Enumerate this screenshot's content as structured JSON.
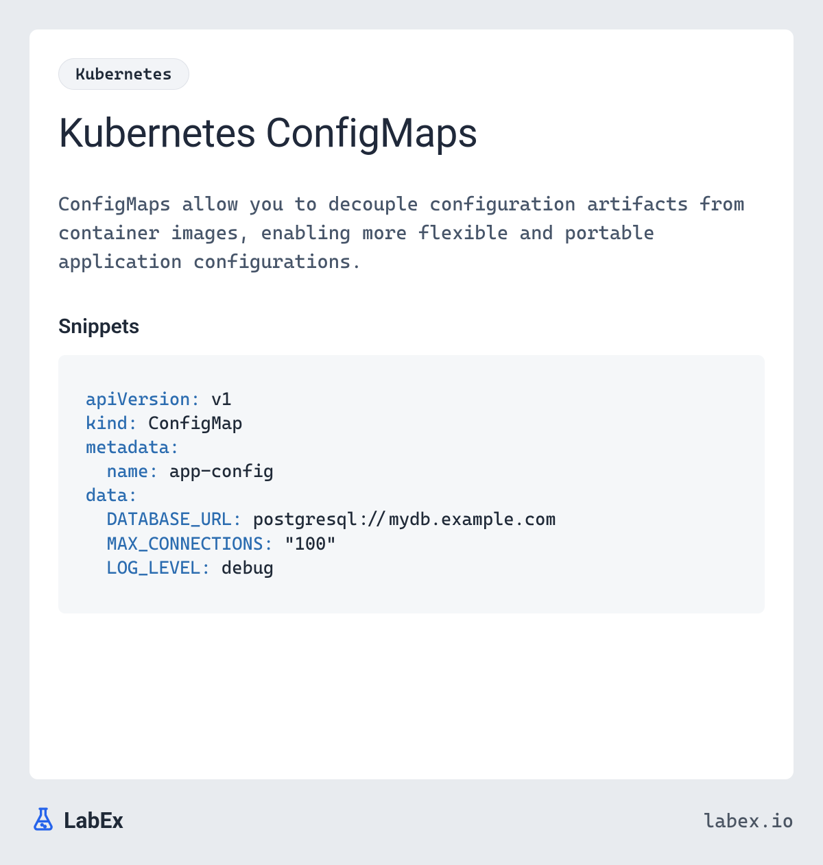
{
  "tag": "Kubernetes",
  "title": "Kubernetes ConfigMaps",
  "description": "ConfigMaps allow you to decouple configuration artifacts from container images, enabling more flexible and portable application configurations.",
  "snippets_heading": "Snippets",
  "code": {
    "lines": [
      {
        "key": "apiVersion:",
        "value": " v1",
        "indent": 0
      },
      {
        "key": "kind:",
        "value": " ConfigMap",
        "indent": 0
      },
      {
        "key": "metadata:",
        "value": "",
        "indent": 0
      },
      {
        "key": "name:",
        "value": " app-config",
        "indent": 1
      },
      {
        "key": "data:",
        "value": "",
        "indent": 0
      },
      {
        "key": "DATABASE_URL:",
        "value": " postgresql://mydb.example.com",
        "indent": 1
      },
      {
        "key": "MAX_CONNECTIONS:",
        "value": " \"100\"",
        "indent": 1
      },
      {
        "key": "LOG_LEVEL:",
        "value": " debug",
        "indent": 1
      }
    ]
  },
  "brand": {
    "name": "LabEx",
    "url": "labex.io"
  }
}
